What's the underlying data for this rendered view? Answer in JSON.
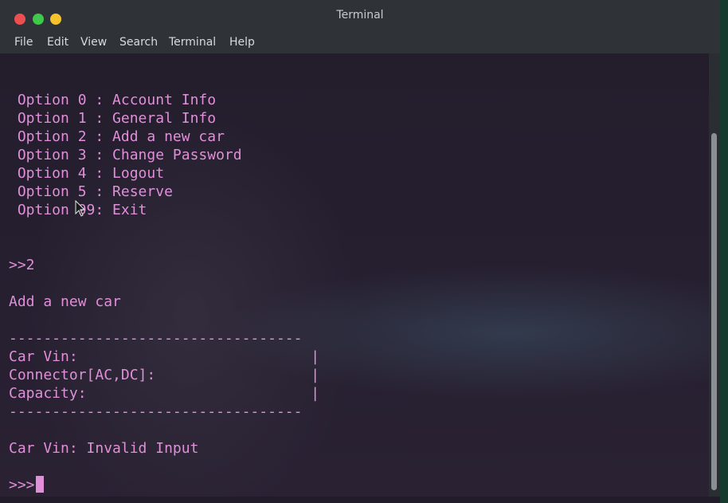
{
  "window": {
    "title": "Terminal"
  },
  "menubar": {
    "items": [
      "File",
      "Edit",
      "View",
      "Search",
      "Terminal",
      "Help"
    ]
  },
  "terminal": {
    "lines": [
      " Option 0 : Account Info",
      " Option 1 : General Info",
      " Option 2 : Add a new car",
      " Option 3 : Change Password",
      " Option 4 : Logout",
      " Option 5 : Reserve",
      " Option 99: Exit",
      ">>2",
      "Add a new car",
      "----------------------------------",
      "Car Vin:                           |",
      "Connector[AC,DC]:                  |",
      "Capacity:                          |",
      "----------------------------------",
      "Car Vin: Invalid Input"
    ],
    "prompt": ">>>"
  },
  "colors": {
    "terminal_text": "#e08fd8",
    "terminal_bg": "#221c2a",
    "titlebar_bg": "#2f3338",
    "close": "#ec4f4f",
    "minimize": "#3fc84a",
    "maximize": "#f5c42c"
  },
  "icons": [
    "close-icon",
    "minimize-icon",
    "maximize-icon",
    "mouse-pointer-icon"
  ]
}
